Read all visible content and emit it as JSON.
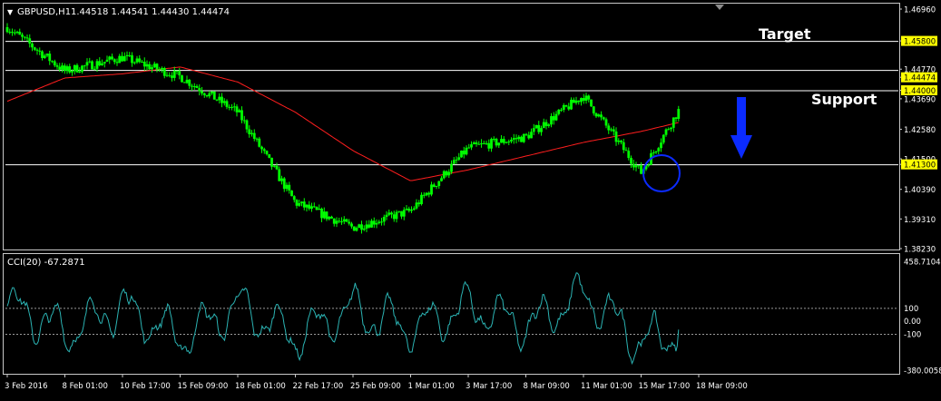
{
  "header": {
    "collapse_glyph": "▼",
    "symbol": "GBPUSD,H1",
    "ohlc": "1.44518 1.44541 1.44430 1.44474"
  },
  "colors": {
    "background": "#000000",
    "frame": "#c8c8c8",
    "candles": "#00ff00",
    "moving_average": "#ff1e1e",
    "cci_line": "#2bb3b3",
    "level_line": "#ffffff",
    "price_tag_bg": "#ffff00",
    "arrow": "#0b2bff",
    "circle": "#0b2bff"
  },
  "annotations": {
    "target_text": "Target",
    "support_text": "Support",
    "down_arrow": "down-arrow-icon",
    "highlight_circle": "circle-highlight-icon"
  },
  "chart_data": [
    {
      "type": "line",
      "series": [
        {
          "role": "price (H1 candles)",
          "x": [
            "3 Feb 2016",
            "8 Feb 01:00",
            "10 Feb 17:00",
            "15 Feb 09:00",
            "18 Feb 01:00",
            "22 Feb 17:00",
            "25 Feb 09:00",
            "1 Mar 01:00",
            "3 Mar 17:00",
            "8 Mar 09:00",
            "11 Mar 01:00",
            "15 Mar 17:00",
            "18 Mar 09:00"
          ],
          "values": [
            1.463,
            1.447,
            1.452,
            1.445,
            1.432,
            1.399,
            1.39,
            1.396,
            1.419,
            1.423,
            1.438,
            1.41,
            1.4447
          ]
        },
        {
          "role": "moving average",
          "x": [
            "3 Feb 2016",
            "8 Feb 01:00",
            "10 Feb 17:00",
            "15 Feb 09:00",
            "18 Feb 01:00",
            "22 Feb 17:00",
            "25 Feb 09:00",
            "1 Mar 01:00",
            "3 Mar 17:00",
            "8 Mar 09:00",
            "11 Mar 01:00",
            "15 Mar 17:00",
            "18 Mar 09:00"
          ],
          "values": [
            1.436,
            1.4445,
            1.446,
            1.4485,
            1.443,
            1.432,
            1.418,
            1.407,
            1.411,
            1.416,
            1.421,
            1.425,
            1.43
          ]
        }
      ],
      "horizontal_levels": [
        1.458,
        1.4474,
        1.44,
        1.413
      ],
      "ylim": [
        1.3823,
        1.4696
      ],
      "y_tick_labels": [
        "1.46960",
        "1.45800",
        "1.44770",
        "1.44474",
        "1.44000",
        "1.43690",
        "1.42580",
        "1.41500",
        "1.41300",
        "1.40390",
        "1.39310",
        "1.38230"
      ],
      "highlighted_price_tags": [
        "1.45800",
        "1.44474",
        "1.44000",
        "1.41300"
      ],
      "x_tick_labels": [
        "3 Feb 2016",
        "8 Feb 01:00",
        "10 Feb 17:00",
        "15 Feb 09:00",
        "18 Feb 01:00",
        "22 Feb 17:00",
        "25 Feb 09:00",
        "1 Mar 01:00",
        "3 Mar 17:00",
        "8 Mar 09:00",
        "11 Mar 01:00",
        "15 Mar 17:00",
        "18 Mar 09:00"
      ],
      "grid": false
    },
    {
      "type": "line",
      "indicator_label": "CCI(20) -67.2871",
      "series": [
        {
          "role": "CCI(20)",
          "x": [
            "3 Feb 2016",
            "8 Feb 01:00",
            "10 Feb 17:00",
            "15 Feb 09:00",
            "18 Feb 01:00",
            "22 Feb 17:00",
            "25 Feb 09:00",
            "1 Mar 01:00",
            "3 Mar 17:00",
            "8 Mar 09:00",
            "11 Mar 01:00",
            "15 Mar 17:00",
            "18 Mar 09:00"
          ],
          "values": [
            300,
            -200,
            250,
            -300,
            250,
            -280,
            200,
            -150,
            250,
            -100,
            458.7104,
            -380.0058,
            -67.2871
          ]
        }
      ],
      "reference_levels": [
        100,
        -100
      ],
      "ylim": [
        -380.0058,
        458.7104
      ],
      "y_tick_labels": [
        "458.7104",
        "100",
        "0.00",
        "-100",
        "-380.0058"
      ]
    }
  ]
}
